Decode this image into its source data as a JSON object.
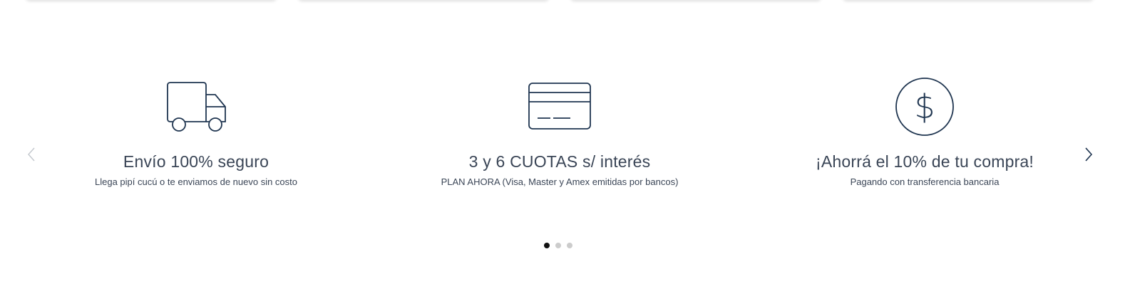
{
  "features": [
    {
      "icon": "truck-icon",
      "title": "Envío 100% seguro",
      "subtitle": "Llega pipí cucú o te enviamos de nuevo sin costo"
    },
    {
      "icon": "credit-card-icon",
      "title": "3 y 6 CUOTAS s/ interés",
      "subtitle": "PLAN AHORA (Visa, Master y Amex emitidas por bancos)"
    },
    {
      "icon": "dollar-coin-icon",
      "title": "¡Ahorrá el 10% de tu compra!",
      "subtitle": "Pagando con transferencia bancaria"
    }
  ],
  "navigation": {
    "prev_icon": "chevron-left-icon",
    "next_icon": "chevron-right-icon"
  },
  "pagination": {
    "total": 3,
    "active": 1
  },
  "colors": {
    "icon_stroke": "#1f3550",
    "text": "#3a4556",
    "dot_active": "#111111",
    "dot_inactive": "#cccccc"
  }
}
